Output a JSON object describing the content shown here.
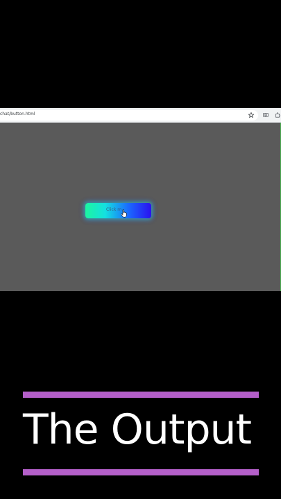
{
  "browser": {
    "url": "chat/button.html",
    "icons": [
      "star-icon",
      "camera-icon",
      "extensions-icon"
    ]
  },
  "page": {
    "button_label": "Click m",
    "background": "#5a5a5a",
    "button_gradient": [
      "#1cf5a0",
      "#14e0e0",
      "#1a6bff",
      "#2a10f0"
    ]
  },
  "caption": {
    "title": "The Output",
    "rule_color": "#b45fc9"
  }
}
